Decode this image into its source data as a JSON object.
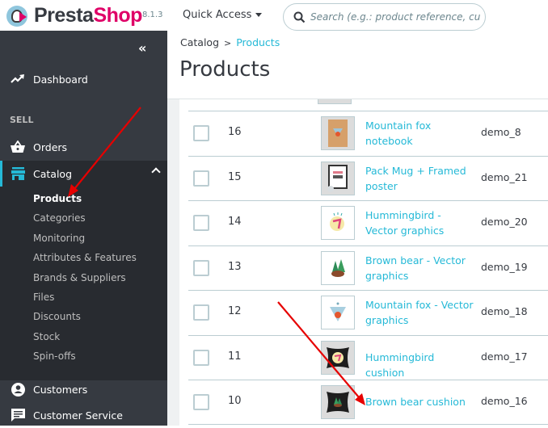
{
  "header": {
    "brand_presta": "Presta",
    "brand_shop": "Shop",
    "version": "8.1.3",
    "quick_access_label": "Quick Access",
    "search_placeholder": "Search (e.g.: product reference, custon"
  },
  "sidebar": {
    "collapse_label": "«",
    "dashboard": "Dashboard",
    "section_sell": "SELL",
    "orders": "Orders",
    "catalog": "Catalog",
    "catalog_children": [
      "Products",
      "Categories",
      "Monitoring",
      "Attributes & Features",
      "Brands & Suppliers",
      "Files",
      "Discounts",
      "Stock",
      "Spin-offs"
    ],
    "active_child": "Products",
    "customers": "Customers",
    "customer_service": "Customer Service",
    "accent_color": "#25b9d7"
  },
  "breadcrumb": {
    "parent": "Catalog",
    "separator": ">",
    "current": "Products"
  },
  "page_title": "Products",
  "products": [
    {
      "id": "16",
      "name": "Mountain fox notebook",
      "reference": "demo_8",
      "thumb": "notebook"
    },
    {
      "id": "15",
      "name": "Pack Mug + Framed poster",
      "reference": "demo_21",
      "thumb": "poster"
    },
    {
      "id": "14",
      "name": "Hummingbird - Vector graphics",
      "reference": "demo_20",
      "thumb": "hummingbird-vector"
    },
    {
      "id": "13",
      "name": "Brown bear - Vector graphics",
      "reference": "demo_19",
      "thumb": "bear-vector"
    },
    {
      "id": "12",
      "name": "Mountain fox - Vector graphics",
      "reference": "demo_18",
      "thumb": "fox-vector"
    },
    {
      "id": "11",
      "name": "Hummingbird cushion",
      "reference": "demo_17",
      "thumb": "hummingbird-cushion"
    },
    {
      "id": "10",
      "name": "Brown bear cushion",
      "reference": "demo_16",
      "thumb": "bear-cushion"
    }
  ],
  "annotations": {
    "arrow_color": "#e60000"
  }
}
